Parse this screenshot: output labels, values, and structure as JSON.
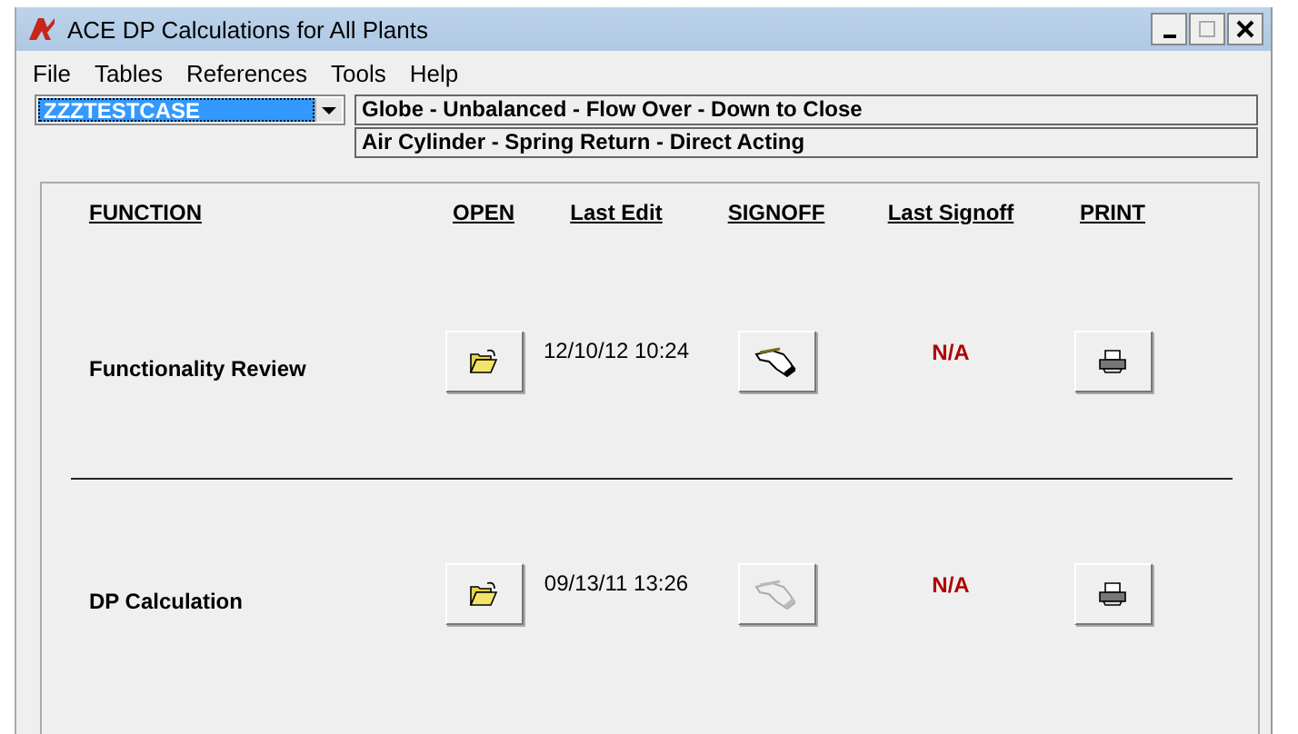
{
  "window": {
    "title": "ACE DP Calculations for All Plants"
  },
  "menu": [
    "File",
    "Tables",
    "References",
    "Tools",
    "Help"
  ],
  "case_select": {
    "value": "ZZZTESTCASE"
  },
  "valve_info": [
    "Globe - Unbalanced - Flow Over - Down to Close",
    "Air Cylinder - Spring Return - Direct Acting"
  ],
  "table": {
    "columns": [
      "FUNCTION",
      "OPEN",
      "Last Edit",
      "SIGNOFF",
      "Last Signoff",
      "PRINT"
    ],
    "rows": [
      {
        "function": "Functionality Review",
        "last_edit": "12/10/12 10:24",
        "signoff_disabled": false,
        "last_signoff": "N/A"
      },
      {
        "function": "DP Calculation",
        "last_edit": "09/13/11 13:26",
        "signoff_disabled": true,
        "last_signoff": "N/A"
      }
    ]
  }
}
